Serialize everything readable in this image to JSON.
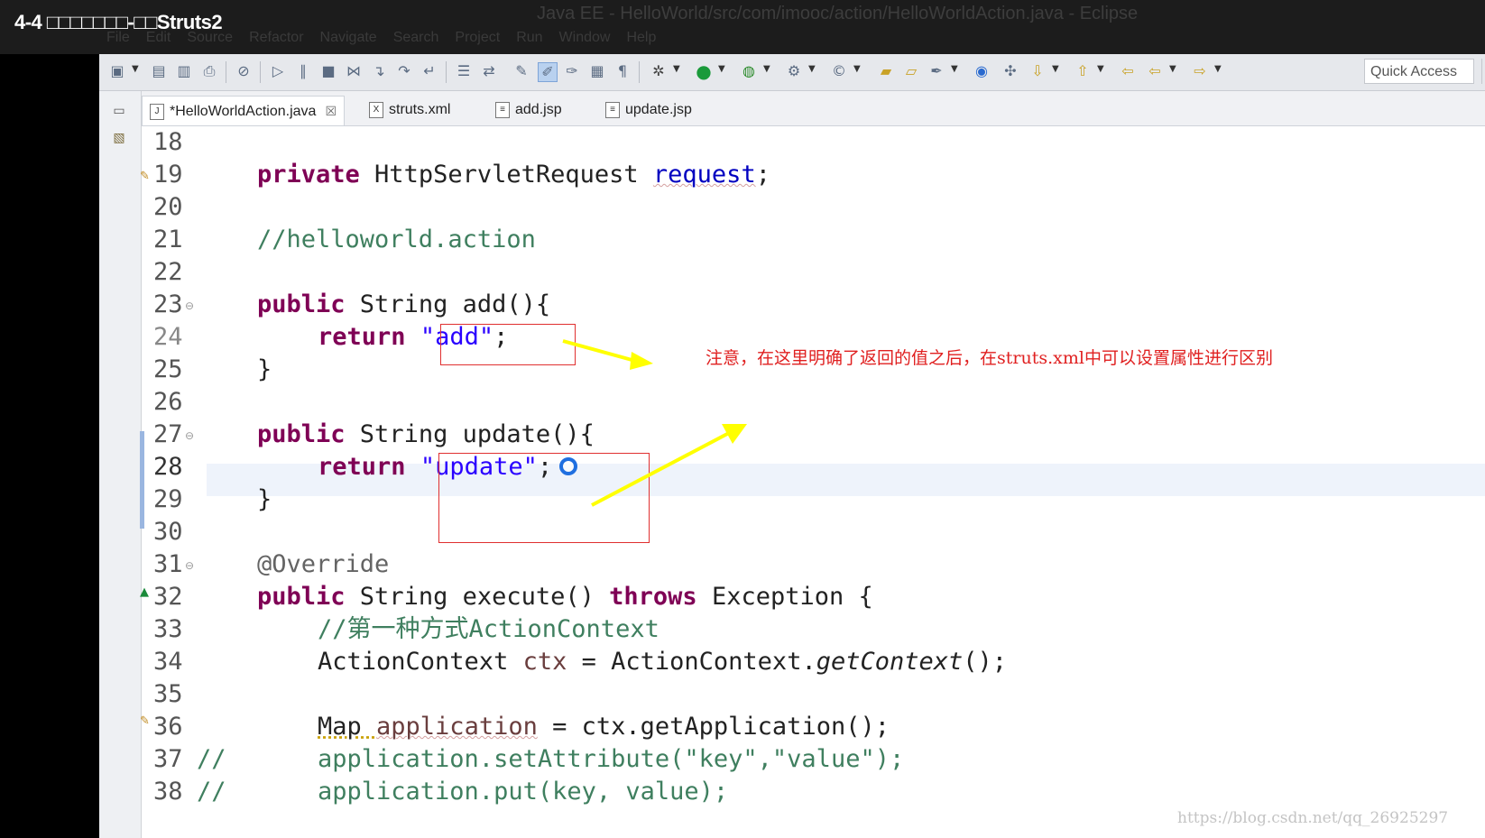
{
  "video": {
    "title": "4-4 □□□□□□□-□□Struts2"
  },
  "window": {
    "title": "Java EE - HelloWorld/src/com/imooc/action/HelloWorldAction.java - Eclipse"
  },
  "menu": [
    "File",
    "Edit",
    "Source",
    "Refactor",
    "Navigate",
    "Search",
    "Project",
    "Run",
    "Window",
    "Help"
  ],
  "toolbar": {
    "quick_access": "Quick Access"
  },
  "tabs": [
    {
      "label": "*HelloWorldAction.java",
      "icon": "J",
      "active": true,
      "close": "☒"
    },
    {
      "label": "struts.xml",
      "icon": "X"
    },
    {
      "label": "add.jsp",
      "icon": "≡"
    },
    {
      "label": "update.jsp",
      "icon": "≡"
    }
  ],
  "code": {
    "l18": "",
    "l19_kw": "private",
    "l19_type": " HttpServletRequest ",
    "l19_field": "request",
    "l19_end": ";",
    "l21": "//helloworld.action",
    "l23_kw": "public",
    "l23_rest": " String add(){",
    "l24_kw": "return",
    "l24_str": "\"add\"",
    "l24_end": ";",
    "l25": "}",
    "l27_kw": "public",
    "l27_rest": " String update(){",
    "l28_kw": "return",
    "l28_str": "\"update\"",
    "l28_end": ";",
    "l29": "}",
    "l31": "@Override",
    "l32_kw": "public",
    "l32_mid": " String execute() ",
    "l32_kw2": "throws",
    "l32_end": " Exception {",
    "l33": "//第一种方式ActionContext",
    "l34_a": "ActionContext ",
    "l34_var": "ctx",
    "l34_b": " = ActionContext.",
    "l34_it": "getContext",
    "l34_c": "();",
    "l36_a": "Map ",
    "l36_var": "application",
    "l36_b": " = ctx.getApplication();",
    "l37_cm": "//",
    "l37": "application.setAttribute(\"key\",\"value\");",
    "l38_cm": "//",
    "l38": "application.put(key, value);"
  },
  "line_numbers": [
    "18",
    "19",
    "20",
    "21",
    "22",
    "23",
    "24",
    "25",
    "26",
    "27",
    "28",
    "29",
    "30",
    "31",
    "32",
    "33",
    "34",
    "35",
    "36",
    "37",
    "38"
  ],
  "annotation": {
    "note": "注意，在这里明确了返回的值之后，在struts.xml中可以设置属性进行区别"
  },
  "watermark": "https://blog.csdn.net/qq_26925297",
  "colors": {
    "keyword": "#7f0055",
    "string": "#2a00ff",
    "comment": "#3f7f5f",
    "annotation_red": "#e02020",
    "arrow": "#ffff00"
  }
}
